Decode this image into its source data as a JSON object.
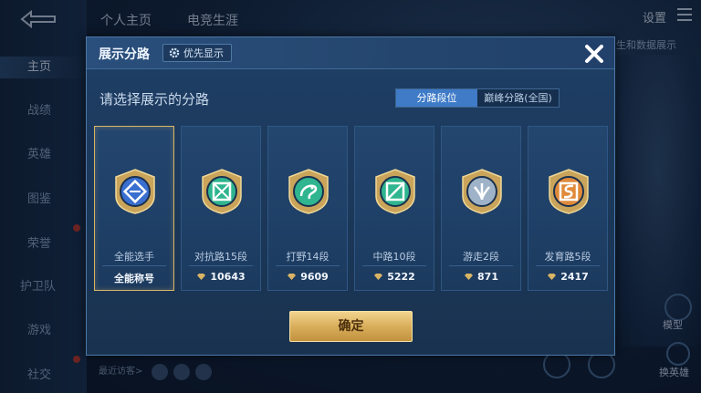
{
  "background": {
    "tabs": [
      "个人主页",
      "电竞生涯"
    ],
    "settings_label": "设置",
    "sidebar": [
      {
        "label": "主页",
        "active": true
      },
      {
        "label": "战绩",
        "active": false
      },
      {
        "label": "英雄",
        "active": false
      },
      {
        "label": "图鉴",
        "active": false
      },
      {
        "label": "荣誉",
        "active": false
      },
      {
        "label": "护卫队",
        "active": false
      },
      {
        "label": "游戏",
        "active": false
      },
      {
        "label": "社交",
        "active": false
      }
    ],
    "right_text": "生和数据展示",
    "right_btn_model": "模型",
    "right_btn_switch": "换英雄",
    "bottom_text": "最近访客>"
  },
  "modal": {
    "title": "展示分路",
    "priority_label": "优先显示",
    "subtitle": "请选择展示的分路",
    "toggle": [
      {
        "label": "分路段位",
        "active": true
      },
      {
        "label": "巅峰分路(全国)",
        "active": false
      }
    ],
    "cards": [
      {
        "label": "全能选手",
        "value": "全能称号",
        "icon": "all-round-badge-icon",
        "selected": true,
        "color": "#3a6fd0",
        "show_diamond": false
      },
      {
        "label": "对抗路15段",
        "value": "10643",
        "icon": "clash-lane-badge-icon",
        "selected": false,
        "color": "#2fb58f",
        "show_diamond": true
      },
      {
        "label": "打野14段",
        "value": "9609",
        "icon": "jungle-badge-icon",
        "selected": false,
        "color": "#2fb58f",
        "show_diamond": true
      },
      {
        "label": "中路10段",
        "value": "5222",
        "icon": "mid-lane-badge-icon",
        "selected": false,
        "color": "#2fb58f",
        "show_diamond": true
      },
      {
        "label": "游走2段",
        "value": "871",
        "icon": "roam-badge-icon",
        "selected": false,
        "color": "#9fb3c8",
        "show_diamond": true
      },
      {
        "label": "发育路5段",
        "value": "2417",
        "icon": "farm-lane-badge-icon",
        "selected": false,
        "color": "#e08a3a",
        "show_diamond": true
      }
    ],
    "confirm_label": "确定"
  },
  "colors": {
    "accent_gold": "#d9b465",
    "toggle_active": "#3f7bc7"
  }
}
